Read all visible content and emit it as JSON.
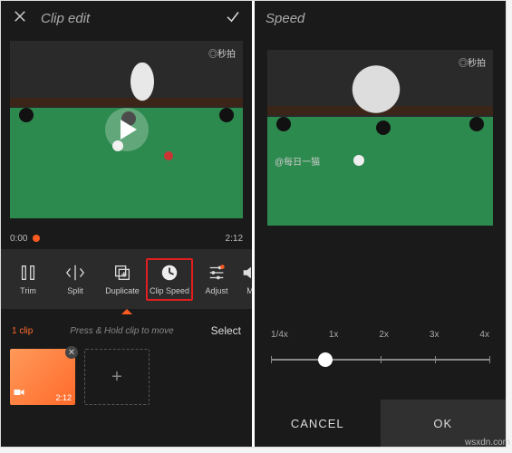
{
  "left": {
    "header": {
      "title": "Clip edit"
    },
    "preview": {
      "watermark": "◎秒拍"
    },
    "timeline": {
      "start": "0:00",
      "end": "2:12"
    },
    "tools": {
      "trim": {
        "label": "Trim"
      },
      "split": {
        "label": "Split"
      },
      "duplicate": {
        "label": "Duplicate"
      },
      "speed": {
        "label": "Clip Speed"
      },
      "adjust": {
        "label": "Adjust"
      },
      "more": {
        "label": "M"
      }
    },
    "cliprow": {
      "count": "1 clip",
      "hint": "Press & Hold clip to move",
      "select": "Select"
    },
    "thumb": {
      "duration": "2:12"
    },
    "add": "+"
  },
  "right": {
    "header": {
      "title": "Speed"
    },
    "preview": {
      "watermark_top": "◎秒拍",
      "watermark_bottom": "@每日一猫"
    },
    "slider": {
      "ticks": [
        "1/4x",
        "1x",
        "2x",
        "3x",
        "4x"
      ],
      "value_index": 1
    },
    "footer": {
      "cancel": "CANCEL",
      "ok": "OK"
    }
  },
  "watermark_site": "wsxdn.com"
}
